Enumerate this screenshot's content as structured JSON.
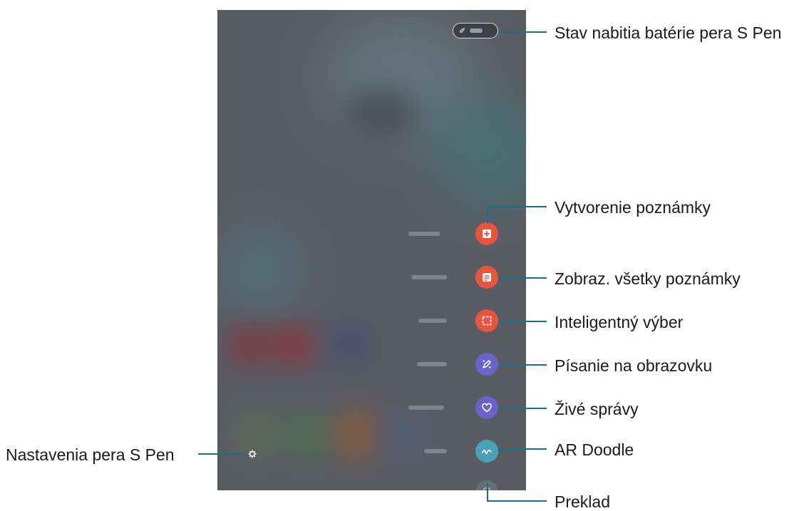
{
  "callouts": {
    "battery": "Stav nabitia batérie pera S Pen",
    "create_note": "Vytvorenie poznámky",
    "view_all_notes": "Zobraz. všetky poznámky",
    "smart_select": "Inteligentný výber",
    "screen_write": "Písanie na obrazovku",
    "live_message": "Živé správy",
    "ar_doodle": "AR Doodle",
    "translate": "Preklad",
    "settings": "Nastavenia pera S Pen"
  },
  "menu_items": [
    {
      "name": "create-note",
      "icon": "note-plus-icon",
      "color": "#e8553f"
    },
    {
      "name": "view-all-notes",
      "icon": "notes-list-icon",
      "color": "#e8553f"
    },
    {
      "name": "smart-select",
      "icon": "dashed-select-icon",
      "color": "#e8553f"
    },
    {
      "name": "screen-write",
      "icon": "pen-write-icon",
      "color": "#6c63c8"
    },
    {
      "name": "live-message",
      "icon": "heart-icon",
      "color": "#6c63c8"
    },
    {
      "name": "ar-doodle",
      "icon": "doodle-squiggle-icon",
      "color": "#4aa0b6"
    },
    {
      "name": "translate",
      "icon": "translate-icon",
      "color": "#6e7d87"
    }
  ],
  "colors": {
    "callout_line": "#1e6d8e",
    "screen_background": "#5a5b62"
  }
}
